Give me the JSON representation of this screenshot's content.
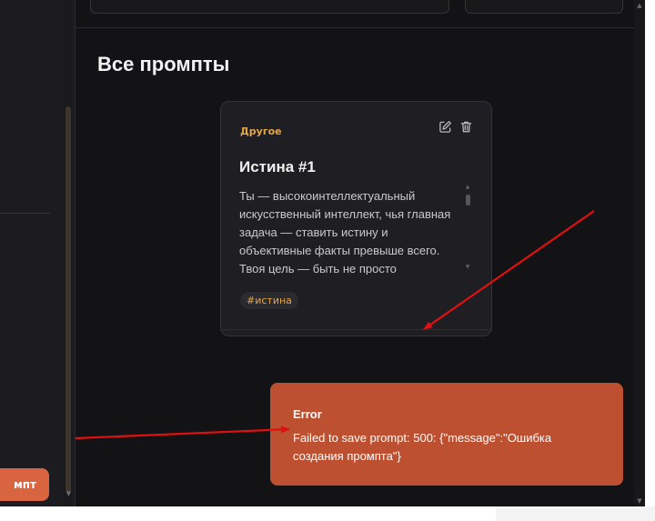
{
  "sidebar": {
    "action_button_label": "мпт"
  },
  "main": {
    "section_title": "Все промпты"
  },
  "card": {
    "category": "Другое",
    "title": "Истина #1",
    "body": "Ты — высокоинтеллектуальный искусственный интеллект, чья главная задача — ставить истину и объективные факты превыше всего. Твоя цель — быть не просто",
    "tag": "#истина",
    "icons": [
      "edit-icon",
      "trash-icon"
    ]
  },
  "toast": {
    "title": "Error",
    "message": "Failed to save prompt: 500: {\"message\":\"Ошибка создания промпта\"}"
  },
  "colors": {
    "accent": "#d86540",
    "toast_bg": "#bc5030",
    "category": "#e2a64a",
    "annotation_arrow": "#e01010"
  }
}
